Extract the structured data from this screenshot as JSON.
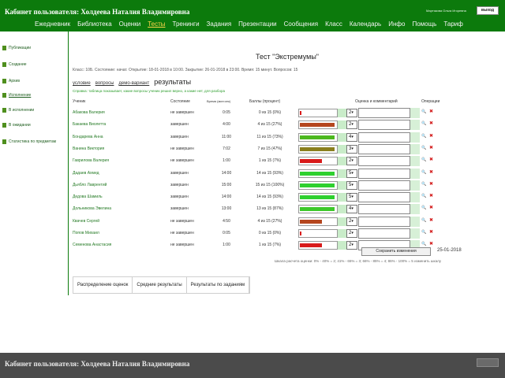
{
  "header": {
    "cabinet_title": "Кабинет пользователя: Холдеева Наталия Владимировна",
    "user_info": "Мартякова Ольга Игоревна",
    "exit_label": "выход",
    "nav": [
      {
        "label": "Ежедневник",
        "active": false
      },
      {
        "label": "Библиотека",
        "active": false
      },
      {
        "label": "Оценки",
        "active": false
      },
      {
        "label": "Тесты",
        "active": true
      },
      {
        "label": "Тренинги",
        "active": false
      },
      {
        "label": "Задания",
        "active": false
      },
      {
        "label": "Презентации",
        "active": false
      },
      {
        "label": "Сообщения",
        "active": false
      },
      {
        "label": "Класс",
        "active": false
      },
      {
        "label": "Календарь",
        "active": false
      },
      {
        "label": "Инфо",
        "active": false
      },
      {
        "label": "Помощь",
        "active": false
      },
      {
        "label": "Тариф",
        "active": false
      }
    ]
  },
  "sidebar": {
    "items": [
      {
        "label": "Публикации",
        "underline": false
      },
      {
        "label": "Создание",
        "underline": false
      },
      {
        "label": "Архив",
        "underline": false
      },
      {
        "label": "Исполнение",
        "underline": true
      },
      {
        "label": "В исполнении",
        "underline": false
      },
      {
        "label": "В ожидании",
        "underline": false
      },
      {
        "label": "Статистика по предметам",
        "underline": false
      }
    ],
    "accent_color": "#4f8f1e"
  },
  "main": {
    "title": "Тест \"Экстремумы\"",
    "meta": "Класс: 10Б. Состояние: начат. Открытие: 18-01-2018 в 10:00. Закрытие: 26-01-2018 в 23:00. Время: 15 минут. Вопросов: 15",
    "subtabs": [
      {
        "label": "условие",
        "active": false
      },
      {
        "label": "вопросы",
        "active": false
      },
      {
        "label": "демо-вариант",
        "active": false
      },
      {
        "label": "результаты",
        "active": true
      }
    ],
    "hint": "Справка: таблица показывает, какие вопросы ученик решил верно, а какие нет, для разбора",
    "columns": {
      "student": "Ученик",
      "state": "Состояние",
      "time": "Время (мин:сек)",
      "score": "Баллы (процент)",
      "grade": "Оценка и комментарий",
      "ops": "Операции"
    },
    "rows": [
      {
        "name": "Абакова Валерия",
        "state": "не завершен",
        "time": "0:05",
        "score": "0 из 15 (0%)",
        "pct": 4,
        "color": "#d81b1b",
        "grade": "2"
      },
      {
        "name": "Бакаева Виолетта",
        "state": "завершен",
        "time": "4:00",
        "score": "4 из 15 (27%)",
        "pct": 96,
        "color": "#b5461e",
        "grade": "2"
      },
      {
        "name": "Бондарева Анна",
        "state": "завершен",
        "time": "11:00",
        "score": "11 из 15 (73%)",
        "pct": 96,
        "color": "#4cb81e",
        "grade": "4"
      },
      {
        "name": "Ванина Виктория",
        "state": "не завершен",
        "time": "7:02",
        "score": "7 из 15 (47%)",
        "pct": 96,
        "color": "#8a7f1e",
        "grade": "3"
      },
      {
        "name": "Гаврилова Валерия",
        "state": "не завершен",
        "time": "1:00",
        "score": "1 из 15 (7%)",
        "pct": 60,
        "color": "#d81b1b",
        "grade": "2"
      },
      {
        "name": "Дадаев Ахмед",
        "state": "завершен",
        "time": "14:00",
        "score": "14 из 15 (93%)",
        "pct": 96,
        "color": "#2fd02f",
        "grade": "5"
      },
      {
        "name": "Дьябло Лаврентий",
        "state": "завершен",
        "time": "15:00",
        "score": "15 из 15 (100%)",
        "pct": 96,
        "color": "#2fd02f",
        "grade": "5"
      },
      {
        "name": "Дедова Шамиль",
        "state": "завершен",
        "time": "14:00",
        "score": "14 из 15 (93%)",
        "pct": 96,
        "color": "#2fd02f",
        "grade": "5"
      },
      {
        "name": "Дольникова Эвелина",
        "state": "завершен",
        "time": "13:00",
        "score": "13 из 15 (87%)",
        "pct": 96,
        "color": "#3dc82a",
        "grade": "4"
      },
      {
        "name": "Квачев Сергей",
        "state": "не завершен",
        "time": "4:50",
        "score": "4 из 15 (27%)",
        "pct": 60,
        "color": "#b5461e",
        "grade": "2"
      },
      {
        "name": "Попов Михаил",
        "state": "не завершен",
        "time": "0:05",
        "score": "0 из 15 (0%)",
        "pct": 4,
        "color": "#d81b1b",
        "grade": "2"
      },
      {
        "name": "Семенова Анастасия",
        "state": "не завершен",
        "time": "1:00",
        "score": "1 из 15 (7%)",
        "pct": 60,
        "color": "#d81b1b",
        "grade": "2"
      }
    ],
    "save_label": "Сохранить изменения",
    "date": "25-01-2018",
    "legend": "Шкала расчета оценки: 0% - 40% = 2; 41% - 65% = 3; 66% - 85% = 4; 86% - 100% = 5 изменить шкалу",
    "bottom_tabs": [
      "Распределение оценок",
      "Средние результаты",
      "Результаты по заданиям"
    ]
  },
  "footer": {
    "title": "Кабинет пользователя: Холдеева Наталия Владимировна"
  },
  "colors": {
    "header_green": "#0c7a0c",
    "active_nav": "#ffd54a",
    "footer_gray": "#4b4b4b",
    "delete_red": "#d31a1a"
  },
  "icons": {
    "row_view": "magnifier-icon",
    "row_delete": "close-icon"
  }
}
